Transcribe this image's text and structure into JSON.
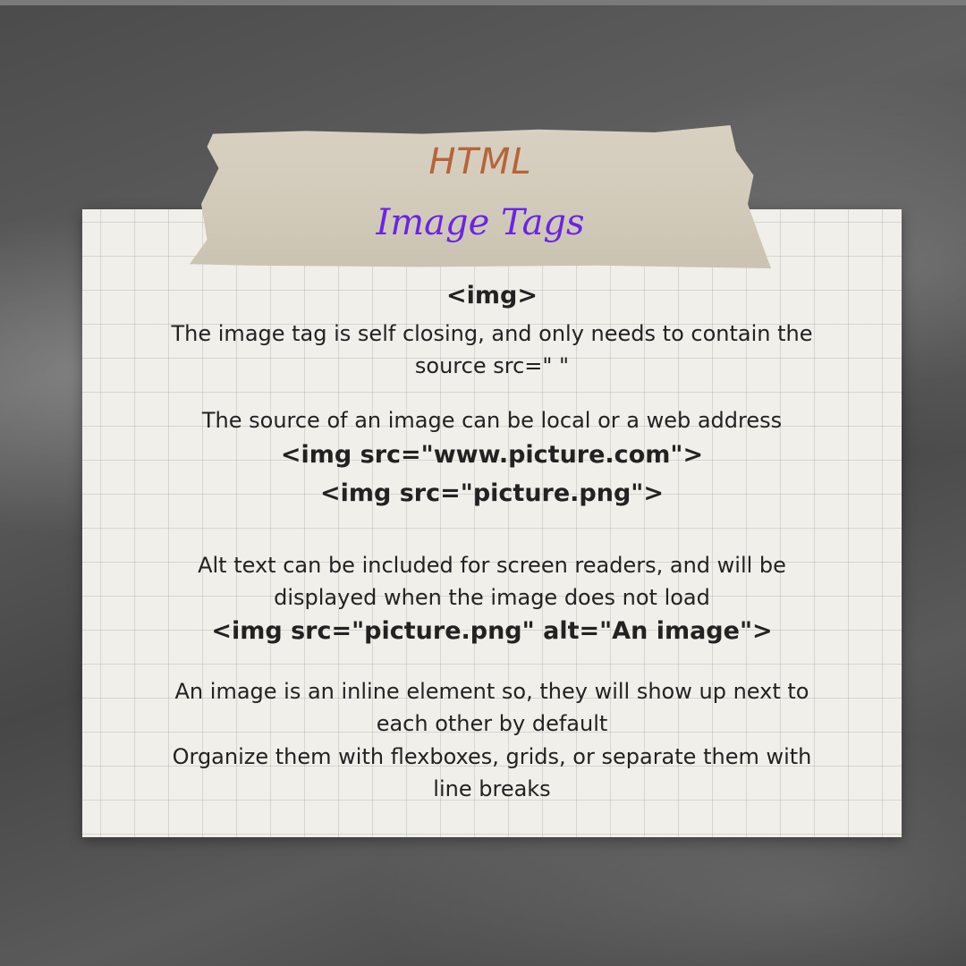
{
  "title": {
    "main": "HTML",
    "sub": "Image Tags"
  },
  "lines": {
    "l1": "<img>",
    "l2": "The image tag is self closing, and only needs to contain the",
    "l3": "source src=\" \"",
    "l4": "The source of an image can be local or a web address",
    "l5": "<img src=\"www.picture.com\">",
    "l6": "<img src=\"picture.png\">",
    "l7": "Alt text can be included for screen readers, and will be",
    "l8": "displayed when the image does not load",
    "l9": "<img src=\"picture.png\" alt=\"An image\">",
    "l10": "An image is an inline element so, they will show up next to",
    "l11": "each other by default",
    "l12": "Organize them with flexboxes, grids, or separate them with",
    "l13": "line breaks"
  },
  "colors": {
    "background": "#525252",
    "paper": "#f1efe9",
    "tape": "#d5cebd",
    "title_main": "#b5653a",
    "title_sub": "#6a24e6",
    "text": "#222222"
  }
}
